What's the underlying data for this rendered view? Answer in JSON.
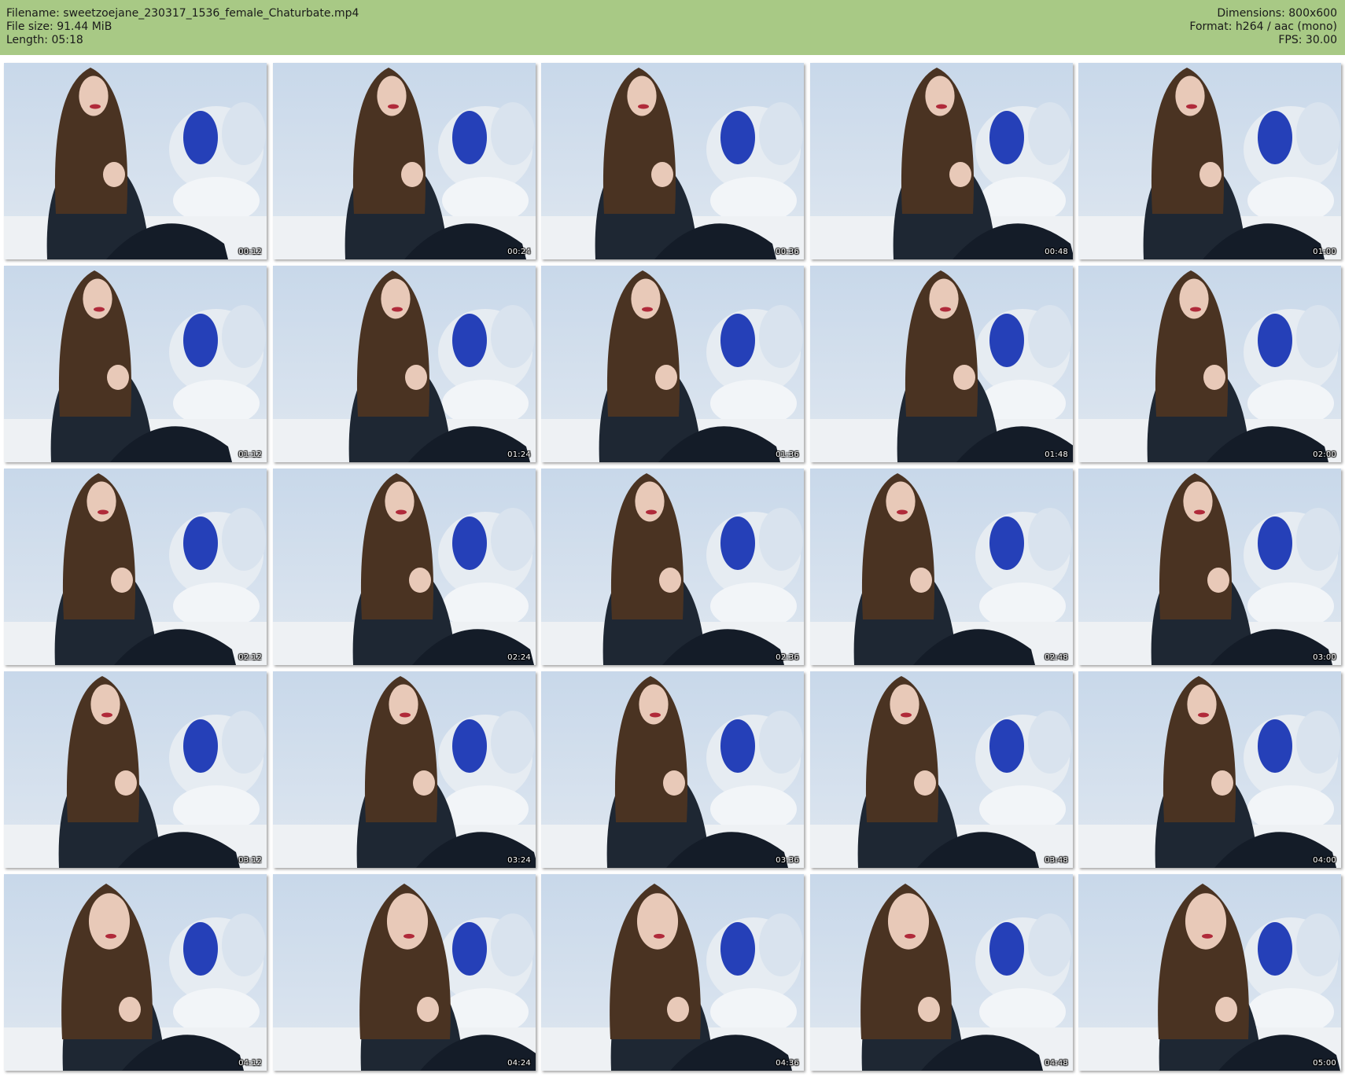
{
  "header": {
    "filename_label": "Filename: sweetzoejane_230317_1536_female_Chaturbate.mp4",
    "filesize_label": "File size: 91.44 MiB",
    "length_label": "Length: 05:18",
    "dimensions_label": "Dimensions: 800x600",
    "format_label": "Format: h264 / aac (mono)",
    "fps_label": "FPS: 30.00"
  },
  "colors": {
    "header_bg": "#a8c985",
    "wall": "#c8d8ea",
    "sofa": "#e6ecf2",
    "cushion_blue": "#2540b8",
    "hair": "#4a3322",
    "clothes": "#1e2733",
    "skin": "#e8c9b8"
  },
  "thumbnails": [
    {
      "time": "00:12"
    },
    {
      "time": "00:24"
    },
    {
      "time": "00:36"
    },
    {
      "time": "00:48"
    },
    {
      "time": "01:00"
    },
    {
      "time": "01:12"
    },
    {
      "time": "01:24"
    },
    {
      "time": "01:36"
    },
    {
      "time": "01:48"
    },
    {
      "time": "02:00"
    },
    {
      "time": "02:12"
    },
    {
      "time": "02:24"
    },
    {
      "time": "02:36"
    },
    {
      "time": "02:48"
    },
    {
      "time": "03:00"
    },
    {
      "time": "03:12"
    },
    {
      "time": "03:24"
    },
    {
      "time": "03:36"
    },
    {
      "time": "03:48"
    },
    {
      "time": "04:00"
    },
    {
      "time": "04:12"
    },
    {
      "time": "04:24"
    },
    {
      "time": "04:36"
    },
    {
      "time": "04:48"
    },
    {
      "time": "05:00"
    }
  ]
}
